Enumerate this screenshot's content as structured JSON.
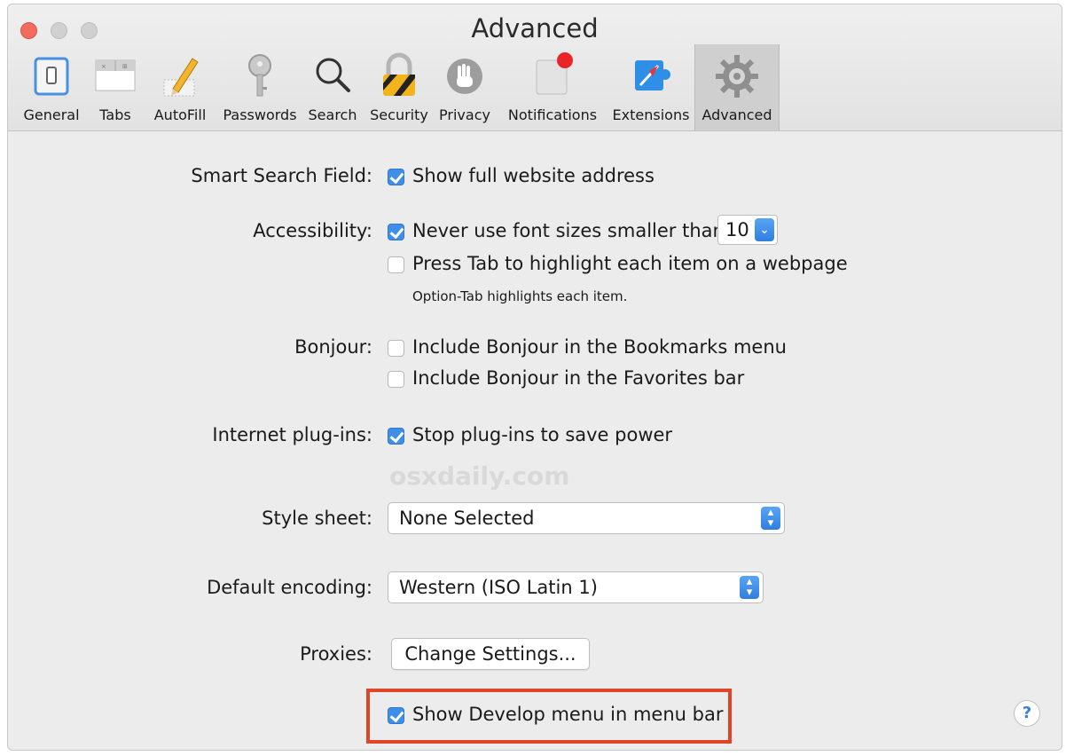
{
  "window": {
    "title": "Advanced"
  },
  "tabs": [
    {
      "label": "General",
      "icon": "general-switch-icon"
    },
    {
      "label": "Tabs",
      "icon": "tabs-icon"
    },
    {
      "label": "AutoFill",
      "icon": "pencil-icon"
    },
    {
      "label": "Passwords",
      "icon": "key-icon"
    },
    {
      "label": "Search",
      "icon": "magnifier-icon"
    },
    {
      "label": "Security",
      "icon": "lock-icon"
    },
    {
      "label": "Privacy",
      "icon": "hand-icon"
    },
    {
      "label": "Notifications",
      "icon": "notification-badge-icon"
    },
    {
      "label": "Extensions",
      "icon": "puzzle-compass-icon"
    },
    {
      "label": "Advanced",
      "icon": "gear-icon"
    }
  ],
  "selected_tab": "Advanced",
  "settings": {
    "smart_search": {
      "label": "Smart Search Field:",
      "option": "Show full website address",
      "checked": true
    },
    "accessibility": {
      "label": "Accessibility:",
      "min_font": {
        "option": "Never use font sizes smaller than",
        "checked": true,
        "value": "10"
      },
      "tab_highlight": {
        "option": "Press Tab to highlight each item on a webpage",
        "checked": false
      },
      "hint": "Option-Tab highlights each item."
    },
    "bonjour": {
      "label": "Bonjour:",
      "bookmarks": {
        "option": "Include Bonjour in the Bookmarks menu",
        "checked": false
      },
      "favorites": {
        "option": "Include Bonjour in the Favorites bar",
        "checked": false
      }
    },
    "plugins": {
      "label": "Internet plug-ins:",
      "option": "Stop plug-ins to save power",
      "checked": true
    },
    "style_sheet": {
      "label": "Style sheet:",
      "value": "None Selected"
    },
    "encoding": {
      "label": "Default encoding:",
      "value": "Western (ISO Latin 1)"
    },
    "proxies": {
      "label": "Proxies:",
      "button": "Change Settings..."
    },
    "develop_menu": {
      "option": "Show Develop menu in menu bar",
      "checked": true
    }
  },
  "watermark": "osxdaily.com",
  "help": "?",
  "colors": {
    "checkbox_blue": "#3f8fe8",
    "highlight_red": "#e0452a",
    "close_red": "#f26b5f"
  }
}
